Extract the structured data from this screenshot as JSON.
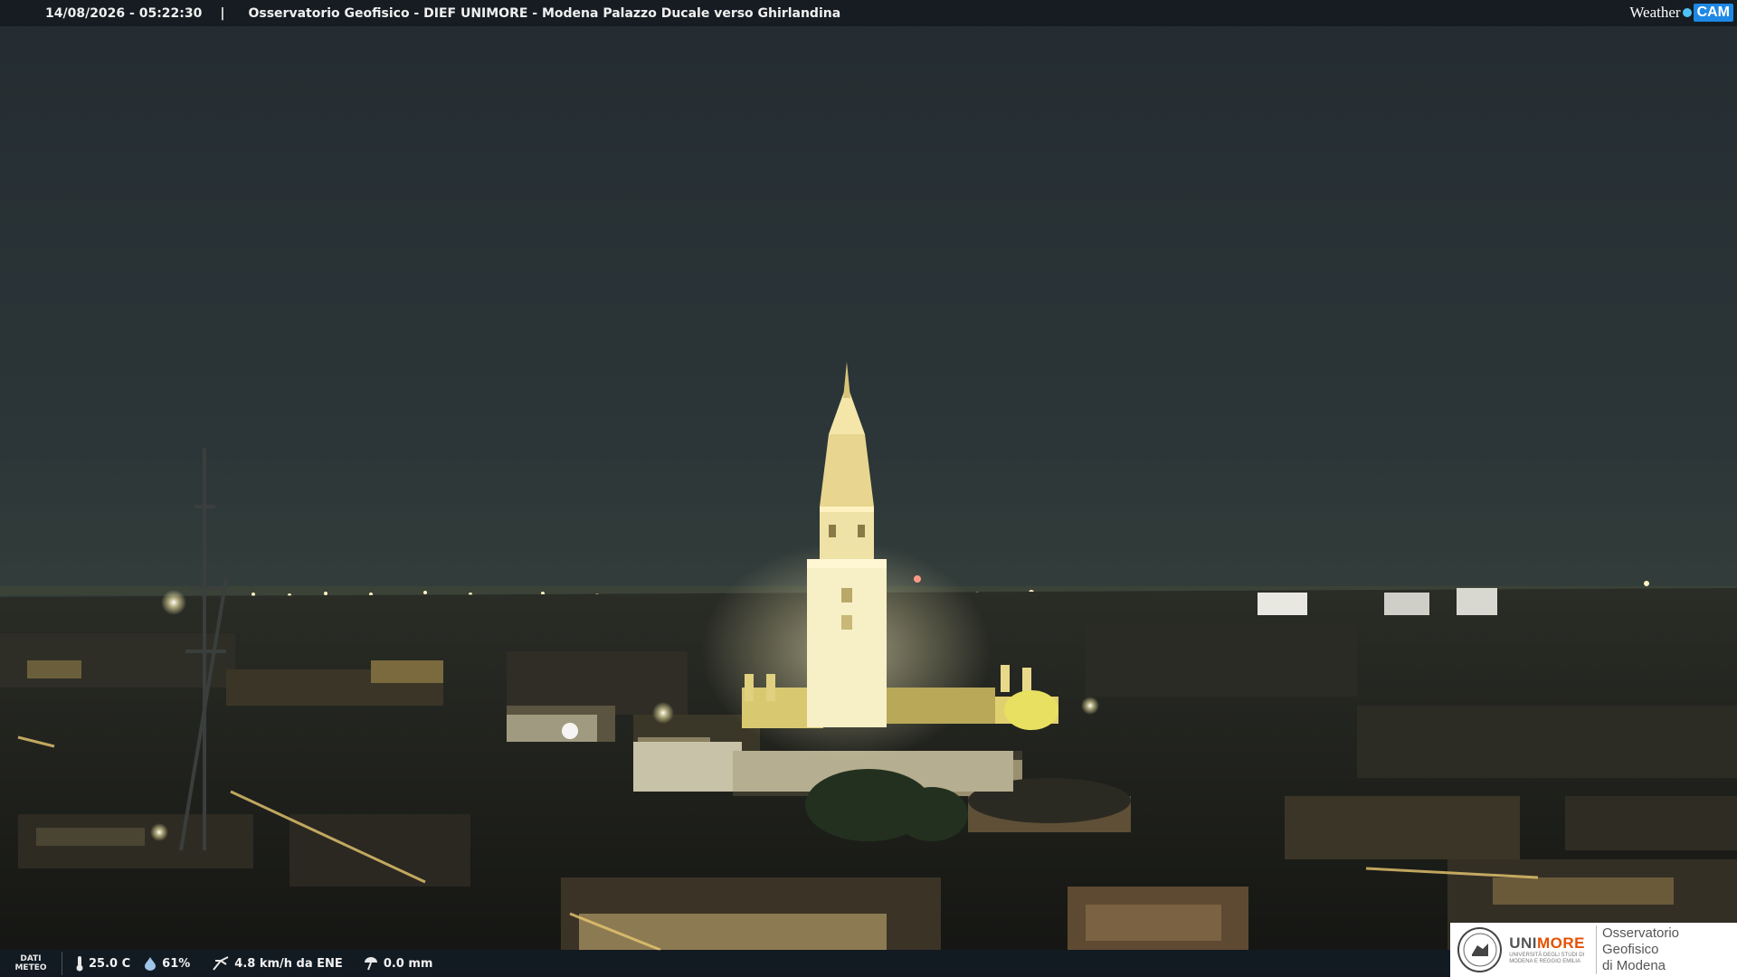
{
  "header": {
    "timestamp": "14/08/2026 - 05:22:30",
    "separator": "|",
    "caption": "Osservatorio Geofisico - DIEF UNIMORE - Modena Palazzo Ducale verso Ghirlandina"
  },
  "brand": {
    "weather": "Weather",
    "cam": "CAM"
  },
  "weather_bar": {
    "label_line1": "DATI",
    "label_line2": "METEO",
    "temperature": "25.0 C",
    "humidity": "61%",
    "wind": "4.8 km/h da ENE",
    "rain": "0.0 mm"
  },
  "logo": {
    "uni_a": "UNI",
    "uni_b": "MORE",
    "uni_sub1": "UNIVERSITÀ DEGLI STUDI DI",
    "uni_sub2": "MODENA E REGGIO EMILIA",
    "obs_line1": "Osservatorio Geofisico",
    "obs_line2": "di Modena"
  },
  "colors": {
    "sky_top": "#262e33",
    "sky_horizon": "#2e3a3d",
    "tower_light": "#f4eab8",
    "city_dark": "#1c1f1c",
    "cam_accent": "#1e88e5",
    "more_accent": "#e65100"
  }
}
